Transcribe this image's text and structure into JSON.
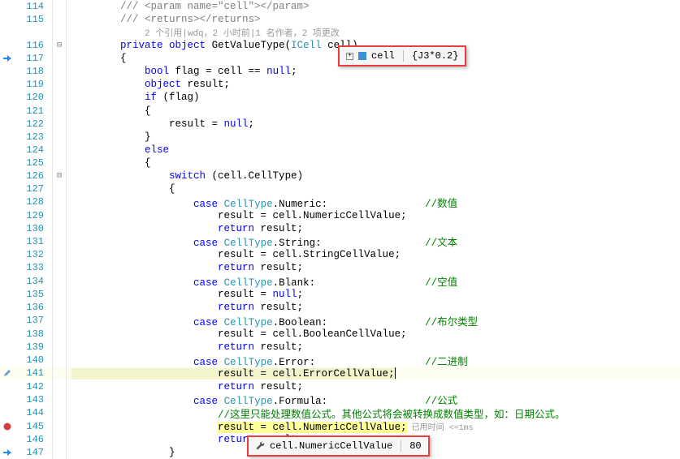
{
  "codelens": "2 个引用|wdq，2 小时前|1 名作者，2 项更改",
  "tooltip1": {
    "var": "cell",
    "val": "{J3*0.2}"
  },
  "tooltip2": {
    "prop": "cell.NumericCellValue",
    "val": "80"
  },
  "timing": "已用时间 <=1ms",
  "lines": [
    {
      "n": 114,
      "indent": 2,
      "ty": "xml",
      "t": "/// <param name=\"cell\"></param>"
    },
    {
      "n": 115,
      "indent": 2,
      "ty": "xml",
      "t": "/// <returns></returns>"
    },
    {
      "n": "",
      "indent": 3,
      "ty": "lens"
    },
    {
      "n": 116,
      "indent": 2,
      "fold": "-",
      "ty": "sig"
    },
    {
      "n": 117,
      "indent": 2,
      "ty": "plain",
      "t": "{",
      "gut": "arrow"
    },
    {
      "n": 118,
      "indent": 3,
      "ty": "decl-flag"
    },
    {
      "n": 119,
      "indent": 3,
      "ty": "decl-result"
    },
    {
      "n": 120,
      "indent": 3,
      "ty": "if"
    },
    {
      "n": 121,
      "indent": 3,
      "ty": "plain",
      "t": "{"
    },
    {
      "n": 122,
      "indent": 4,
      "ty": "assign-null"
    },
    {
      "n": 123,
      "indent": 3,
      "ty": "plain",
      "t": "}"
    },
    {
      "n": 124,
      "indent": 3,
      "ty": "else"
    },
    {
      "n": 125,
      "indent": 3,
      "ty": "plain",
      "t": "{"
    },
    {
      "n": 126,
      "indent": 4,
      "fold": "-",
      "ty": "switch"
    },
    {
      "n": 127,
      "indent": 4,
      "ty": "plain",
      "t": "{"
    },
    {
      "n": 128,
      "indent": 5,
      "ty": "case",
      "member": "Numeric",
      "cm": "//数值"
    },
    {
      "n": 129,
      "indent": 6,
      "ty": "assign-prop",
      "prop": "NumericCellValue"
    },
    {
      "n": 130,
      "indent": 6,
      "ty": "return"
    },
    {
      "n": 131,
      "indent": 5,
      "ty": "case",
      "member": "String",
      "cm": "//文本"
    },
    {
      "n": 132,
      "indent": 6,
      "ty": "assign-prop",
      "prop": "StringCellValue"
    },
    {
      "n": 133,
      "indent": 6,
      "ty": "return"
    },
    {
      "n": 134,
      "indent": 5,
      "ty": "case",
      "member": "Blank",
      "cm": "//空值"
    },
    {
      "n": 135,
      "indent": 6,
      "ty": "assign-null"
    },
    {
      "n": 136,
      "indent": 6,
      "ty": "return"
    },
    {
      "n": 137,
      "indent": 5,
      "ty": "case",
      "member": "Boolean",
      "cm": "//布尔类型"
    },
    {
      "n": 138,
      "indent": 6,
      "ty": "assign-prop",
      "prop": "BooleanCellValue"
    },
    {
      "n": 139,
      "indent": 6,
      "ty": "return"
    },
    {
      "n": 140,
      "indent": 5,
      "ty": "case",
      "member": "Error",
      "cm": "//二进制"
    },
    {
      "n": 141,
      "indent": 6,
      "ty": "assign-prop-cur",
      "prop": "ErrorCellValue",
      "gut": "pen"
    },
    {
      "n": 142,
      "indent": 6,
      "ty": "return"
    },
    {
      "n": 143,
      "indent": 5,
      "ty": "case",
      "member": "Formula",
      "cm": "//公式"
    },
    {
      "n": 144,
      "indent": 6,
      "ty": "cmt",
      "t": "//这里只能处理数值公式。其他公式将会被转换成数值类型，如：日期公式。"
    },
    {
      "n": 145,
      "indent": 6,
      "ty": "assign-prop-hl",
      "prop": "NumericCellValue",
      "gut": "bp"
    },
    {
      "n": 146,
      "indent": 6,
      "ty": "return"
    },
    {
      "n": 147,
      "indent": 4,
      "ty": "plain",
      "t": "}",
      "gut": "arrow"
    }
  ]
}
